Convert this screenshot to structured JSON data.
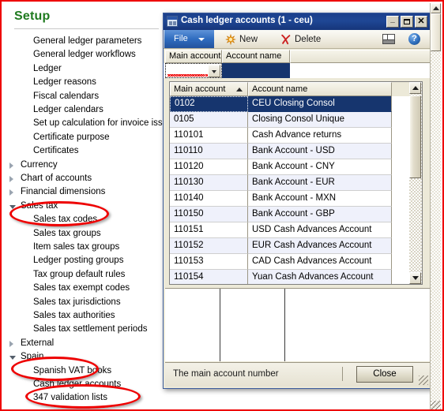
{
  "colors": {
    "annotation": "#ee0000",
    "title_green": "#1f7a1f",
    "titlebar_blue": "#1b3f8b",
    "selection_blue": "#16356e"
  },
  "sidebar": {
    "title": "Setup",
    "items": [
      {
        "label": "General ledger parameters",
        "indent": 1,
        "expander": "none"
      },
      {
        "label": "General ledger workflows",
        "indent": 1,
        "expander": "none"
      },
      {
        "label": "Ledger",
        "indent": 1,
        "expander": "none"
      },
      {
        "label": "Ledger reasons",
        "indent": 1,
        "expander": "none"
      },
      {
        "label": "Fiscal calendars",
        "indent": 1,
        "expander": "none"
      },
      {
        "label": "Ledger calendars",
        "indent": 1,
        "expander": "none"
      },
      {
        "label": "Set up calculation for invoice issue",
        "indent": 1,
        "expander": "none"
      },
      {
        "label": "Certificate purpose",
        "indent": 1,
        "expander": "none"
      },
      {
        "label": "Certificates",
        "indent": 1,
        "expander": "none"
      },
      {
        "label": "Currency",
        "indent": 0,
        "expander": "collapsed"
      },
      {
        "label": "Chart of accounts",
        "indent": 0,
        "expander": "collapsed"
      },
      {
        "label": "Financial dimensions",
        "indent": 0,
        "expander": "collapsed"
      },
      {
        "label": "Sales tax",
        "indent": 0,
        "expander": "expanded"
      },
      {
        "label": "Sales tax codes",
        "indent": 1,
        "expander": "none"
      },
      {
        "label": "Sales tax groups",
        "indent": 1,
        "expander": "none"
      },
      {
        "label": "Item sales tax groups",
        "indent": 1,
        "expander": "none"
      },
      {
        "label": "Ledger posting groups",
        "indent": 1,
        "expander": "none"
      },
      {
        "label": "Tax group default rules",
        "indent": 1,
        "expander": "none"
      },
      {
        "label": "Sales tax exempt codes",
        "indent": 1,
        "expander": "none"
      },
      {
        "label": "Sales tax jurisdictions",
        "indent": 1,
        "expander": "none"
      },
      {
        "label": "Sales tax authorities",
        "indent": 1,
        "expander": "none"
      },
      {
        "label": "Sales tax settlement periods",
        "indent": 1,
        "expander": "none"
      },
      {
        "label": "External",
        "indent": 0,
        "expander": "collapsed"
      },
      {
        "label": "Spain",
        "indent": 0,
        "expander": "expanded"
      },
      {
        "label": "Spanish VAT books",
        "indent": 1,
        "expander": "none"
      },
      {
        "label": "Cash ledger accounts",
        "indent": 1,
        "expander": "none"
      },
      {
        "label": "347 validation lists",
        "indent": 1,
        "expander": "none"
      }
    ],
    "highlighted": [
      "Sales tax",
      "Spain",
      "Cash ledger accounts"
    ]
  },
  "dialog": {
    "title": "Cash ledger accounts (1 - ceu)",
    "title_icon": "window-grid-icon",
    "window_buttons": {
      "minimize": "_",
      "maximize": "□",
      "close": "✕"
    },
    "toolbar": {
      "file_label": "File",
      "new_label": "New",
      "delete_label": "Delete",
      "grid_icon": "split-view-icon",
      "help_icon": "help-icon",
      "help_glyph": "?"
    },
    "filter_bar": {
      "columns": [
        "Main account",
        "Account name",
        ""
      ],
      "input_value": "",
      "input_has_error": true,
      "dropdown_icon": "chevron-down-icon"
    },
    "grid": {
      "columns": [
        "Main account",
        "Account name"
      ],
      "sort_column": "Main account",
      "sort_direction": "ascending",
      "selected_row_index": 0,
      "rows": [
        {
          "main_account": "0102",
          "account_name": "CEU Closing Consol"
        },
        {
          "main_account": "0105",
          "account_name": "Closing Consol Unique"
        },
        {
          "main_account": "110101",
          "account_name": "Cash Advance returns"
        },
        {
          "main_account": "110110",
          "account_name": "Bank Account - USD"
        },
        {
          "main_account": "110120",
          "account_name": "Bank Account - CNY"
        },
        {
          "main_account": "110130",
          "account_name": "Bank Account - EUR"
        },
        {
          "main_account": "110140",
          "account_name": "Bank Account - MXN"
        },
        {
          "main_account": "110150",
          "account_name": "Bank Account - GBP"
        },
        {
          "main_account": "110151",
          "account_name": "USD Cash Advances Account"
        },
        {
          "main_account": "110152",
          "account_name": "EUR Cash Advances Account"
        },
        {
          "main_account": "110153",
          "account_name": "CAD Cash Advances Account"
        },
        {
          "main_account": "110154",
          "account_name": "Yuan Cash Advances Account"
        }
      ]
    },
    "status": {
      "message": "The main account number",
      "close_label": "Close"
    }
  }
}
